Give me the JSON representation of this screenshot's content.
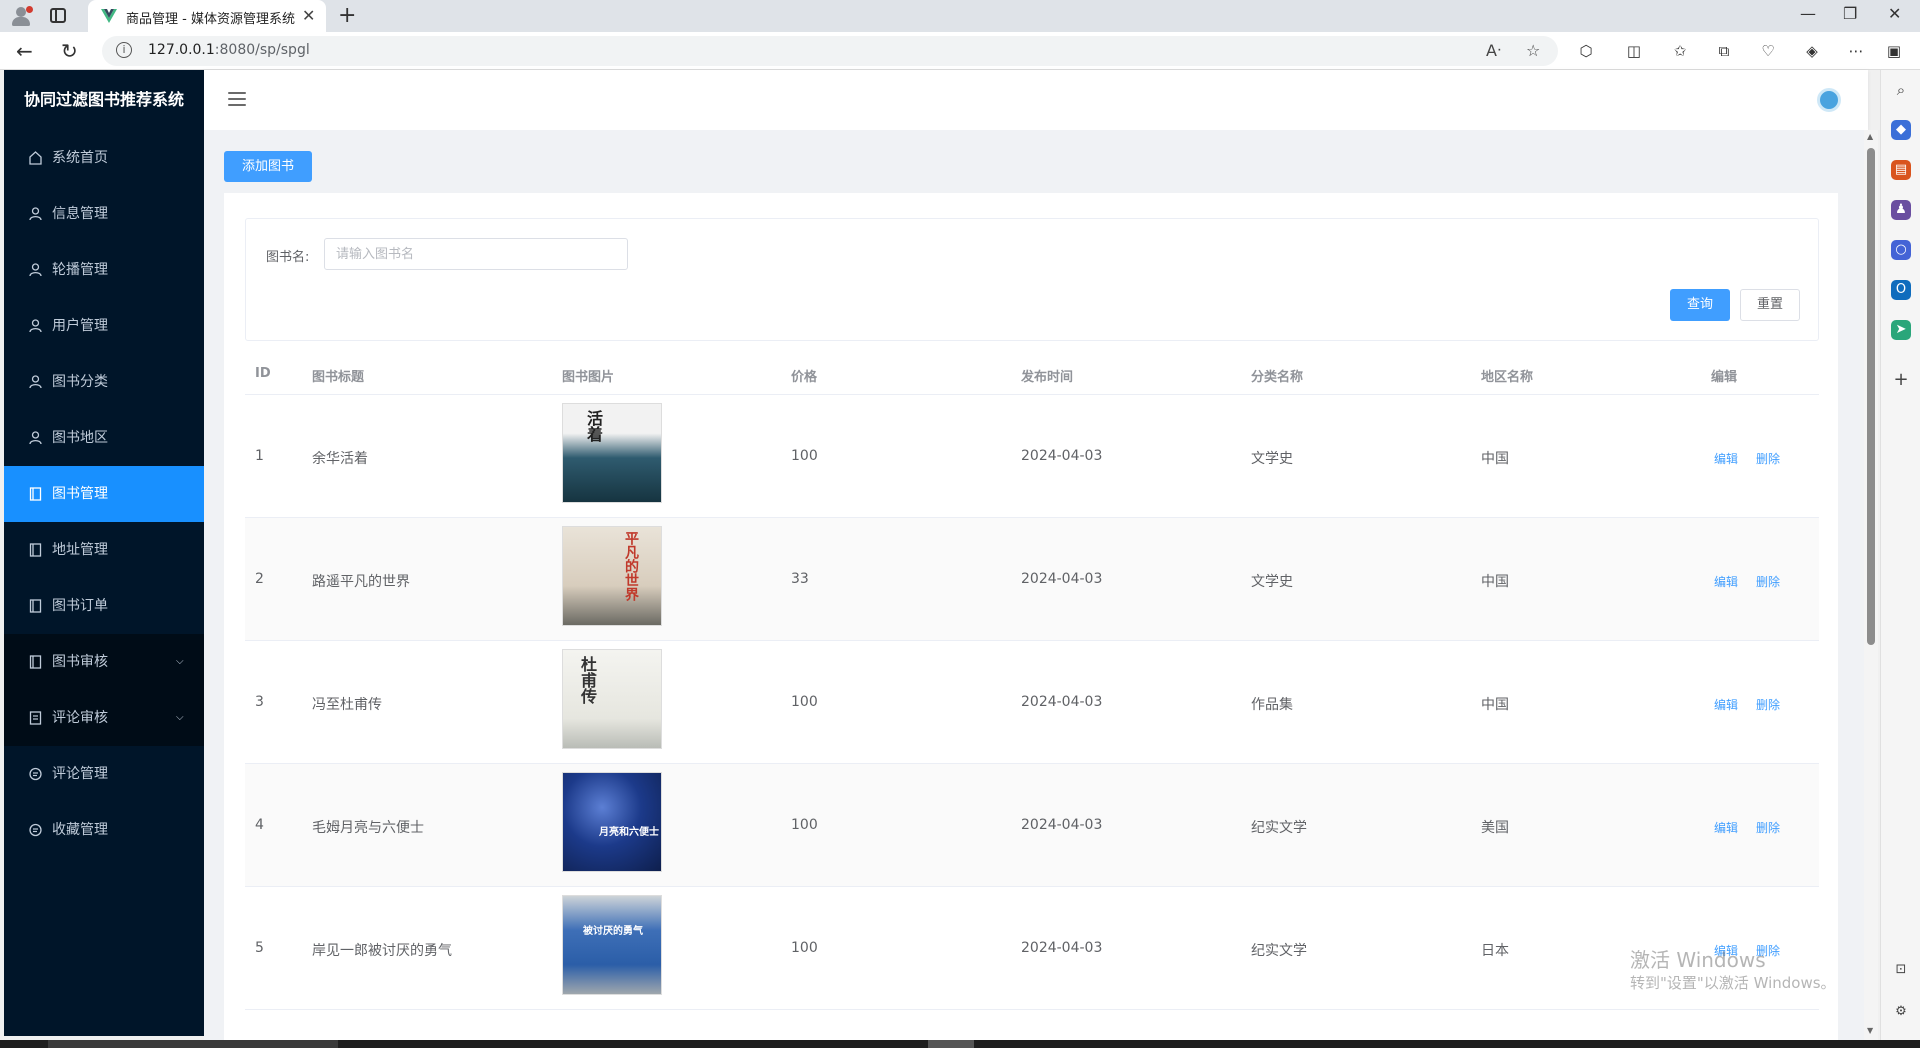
{
  "browser": {
    "tab_title": "商品管理 - 媒体资源管理系统",
    "url_host": "127.0.0.1",
    "url_rest": ":8080/sp/spgl"
  },
  "sidebar": {
    "brand": "协同过滤图书推荐系统",
    "items": [
      {
        "label": "系统首页",
        "icon": "home-icon"
      },
      {
        "label": "信息管理",
        "icon": "user-icon"
      },
      {
        "label": "轮播管理",
        "icon": "user-icon"
      },
      {
        "label": "用户管理",
        "icon": "user-icon"
      },
      {
        "label": "图书分类",
        "icon": "user-icon"
      },
      {
        "label": "图书地区",
        "icon": "user-icon"
      },
      {
        "label": "图书管理",
        "icon": "book-icon",
        "active": true
      },
      {
        "label": "地址管理",
        "icon": "book-icon"
      },
      {
        "label": "图书订单",
        "icon": "book-icon"
      },
      {
        "label": "图书审核",
        "icon": "book-icon",
        "submenu": true
      },
      {
        "label": "评论审核",
        "icon": "document-icon",
        "submenu": true
      },
      {
        "label": "评论管理",
        "icon": "chat-icon"
      },
      {
        "label": "收藏管理",
        "icon": "chat-icon"
      }
    ]
  },
  "toolbar": {
    "add_label": "添加图书"
  },
  "search": {
    "label": "图书名:",
    "placeholder": "请输入图书名",
    "query_label": "查询",
    "reset_label": "重置"
  },
  "table": {
    "headers": [
      "ID",
      "图书标题",
      "图书图片",
      "价格",
      "发布时间",
      "分类名称",
      "地区名称",
      "编辑"
    ],
    "rows": [
      {
        "id": "1",
        "title": "余华活着",
        "cover_text": "活着",
        "price": "100",
        "date": "2024-04-03",
        "category": "文学史",
        "region": "中国"
      },
      {
        "id": "2",
        "title": "路遥平凡的世界",
        "cover_text": "平凡的世界",
        "price": "33",
        "date": "2024-04-03",
        "category": "文学史",
        "region": "中国"
      },
      {
        "id": "3",
        "title": "冯至杜甫传",
        "cover_text": "杜甫传",
        "price": "100",
        "date": "2024-04-03",
        "category": "作品集",
        "region": "中国"
      },
      {
        "id": "4",
        "title": "毛姆月亮与六便士",
        "cover_text": "月亮和六便士",
        "price": "100",
        "date": "2024-04-03",
        "category": "纪实文学",
        "region": "美国"
      },
      {
        "id": "5",
        "title": "岸见一郎被讨厌的勇气",
        "cover_text": "被讨厌的勇气",
        "price": "100",
        "date": "2024-04-03",
        "category": "纪实文学",
        "region": "日本"
      }
    ],
    "edit_label": "编辑",
    "delete_label": "删除"
  },
  "watermark": {
    "line1": "激活 Windows",
    "line2": "转到\"设置\"以激活 Windows。"
  },
  "colors": {
    "sidebar_bg": "#001529",
    "active_menu": "#1890ff",
    "primary": "#409eff"
  }
}
